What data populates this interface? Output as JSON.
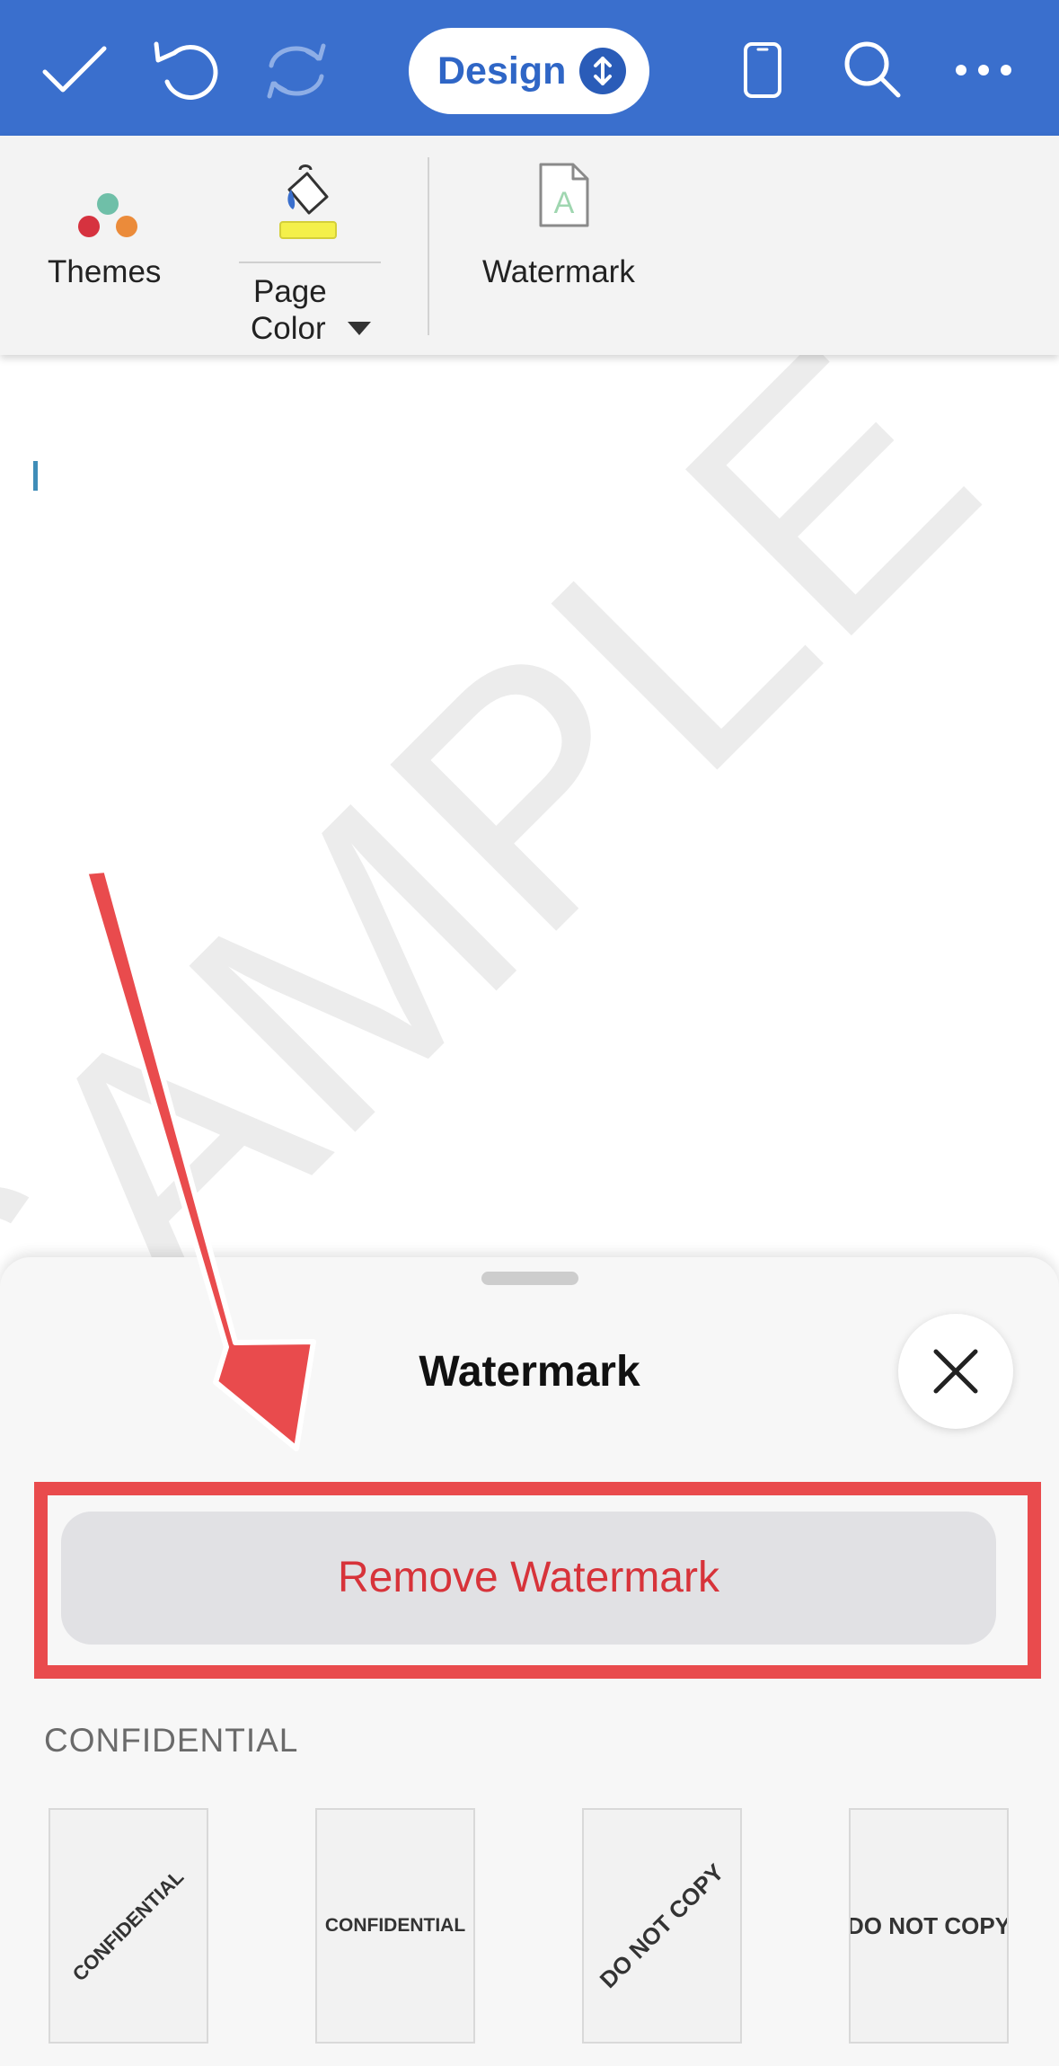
{
  "toolbar": {
    "active_tab": "Design",
    "icons": [
      "checkmark-icon",
      "undo-icon",
      "redo-icon",
      "switch-tab-icon",
      "phone-view-icon",
      "search-icon",
      "more-icon"
    ]
  },
  "ribbon": {
    "themes_label": "Themes",
    "page_color_label_line1": "Page",
    "page_color_label_line2": "Color",
    "watermark_label": "Watermark"
  },
  "document": {
    "watermark_text": "SAMPLE"
  },
  "sheet": {
    "title": "Watermark",
    "remove_button_label": "Remove Watermark",
    "section_heading": "CONFIDENTIAL",
    "thumbnails": [
      {
        "text": "CONFIDENTIAL",
        "orientation": "diagonal"
      },
      {
        "text": "CONFIDENTIAL",
        "orientation": "horizontal"
      },
      {
        "text": "DO NOT COPY",
        "orientation": "diagonal"
      },
      {
        "text": "DO NOT COPY",
        "orientation": "horizontal"
      }
    ]
  },
  "colors": {
    "toolbar_bg": "#3a6fcd",
    "ribbon_bg": "#f3f3f3",
    "remove_text": "#d7333a",
    "annotation_red": "#e94b4d"
  }
}
